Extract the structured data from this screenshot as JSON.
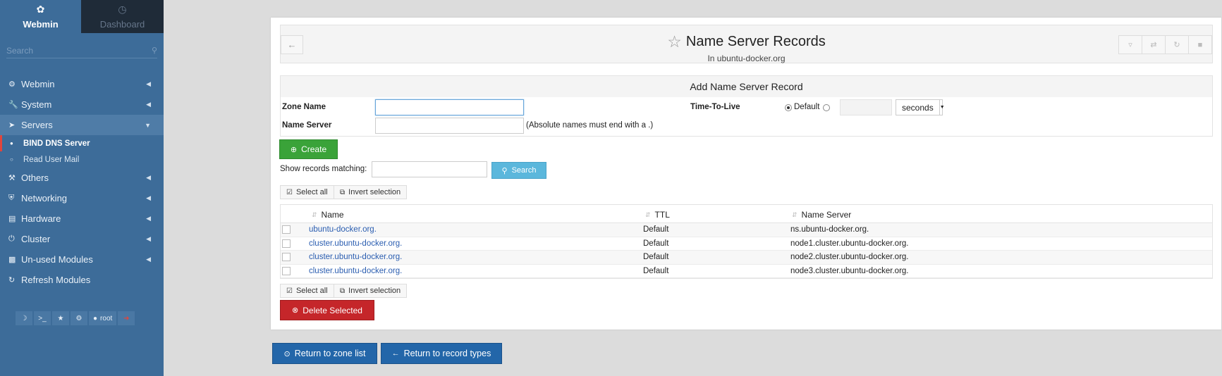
{
  "sidebar": {
    "tabs": [
      {
        "label": "Webmin",
        "icon": "webmin-logo-icon"
      },
      {
        "label": "Dashboard",
        "icon": "dashboard-gauge-icon"
      }
    ],
    "search_placeholder": "Search",
    "menu": [
      {
        "label": "Webmin",
        "icon": "gear-icon"
      },
      {
        "label": "System",
        "icon": "wrench-icon"
      },
      {
        "label": "Servers",
        "icon": "rocket-icon"
      },
      {
        "label": "Others",
        "icon": "hammer-icon"
      },
      {
        "label": "Networking",
        "icon": "shield-icon"
      },
      {
        "label": "Hardware",
        "icon": "hdd-icon"
      },
      {
        "label": "Cluster",
        "icon": "power-icon"
      },
      {
        "label": "Un-used Modules",
        "icon": "puzzle-icon"
      },
      {
        "label": "Refresh Modules",
        "icon": "refresh-icon"
      }
    ],
    "submenu": [
      "BIND DNS Server",
      "Read User Mail"
    ],
    "bottom": {
      "user": "root"
    }
  },
  "header": {
    "title": "Name Server Records",
    "subtitle": "In ubuntu-docker.org"
  },
  "form": {
    "title": "Add Name Server Record",
    "zone_label": "Zone Name",
    "zone_value": "",
    "ttl_label": "Time-To-Live",
    "ttl_default_label": "Default",
    "ttl_unit": "seconds",
    "ns_label": "Name Server",
    "ns_value": "",
    "ns_hint": "(Absolute names must end with a .)"
  },
  "actions": {
    "create": "Create",
    "show_matching": "Show records matching:",
    "search": "Search",
    "select_all": "Select all",
    "invert_selection": "Invert selection",
    "delete_selected": "Delete Selected",
    "return_zone": "Return to zone list",
    "return_types": "Return to record types"
  },
  "table": {
    "columns": [
      "Name",
      "TTL",
      "Name Server"
    ],
    "rows": [
      {
        "name": "ubuntu-docker.org.",
        "ttl": "Default",
        "ns": "ns.ubuntu-docker.org."
      },
      {
        "name": "cluster.ubuntu-docker.org.",
        "ttl": "Default",
        "ns": "node1.cluster.ubuntu-docker.org."
      },
      {
        "name": "cluster.ubuntu-docker.org.",
        "ttl": "Default",
        "ns": "node2.cluster.ubuntu-docker.org."
      },
      {
        "name": "cluster.ubuntu-docker.org.",
        "ttl": "Default",
        "ns": "node3.cluster.ubuntu-docker.org."
      }
    ]
  },
  "colors": {
    "sidebar_bg": "#3d6c99",
    "create_green": "#3aa339",
    "delete_red": "#c5262a",
    "link_blue": "#2a5db0",
    "button_blue": "#2366a9"
  }
}
